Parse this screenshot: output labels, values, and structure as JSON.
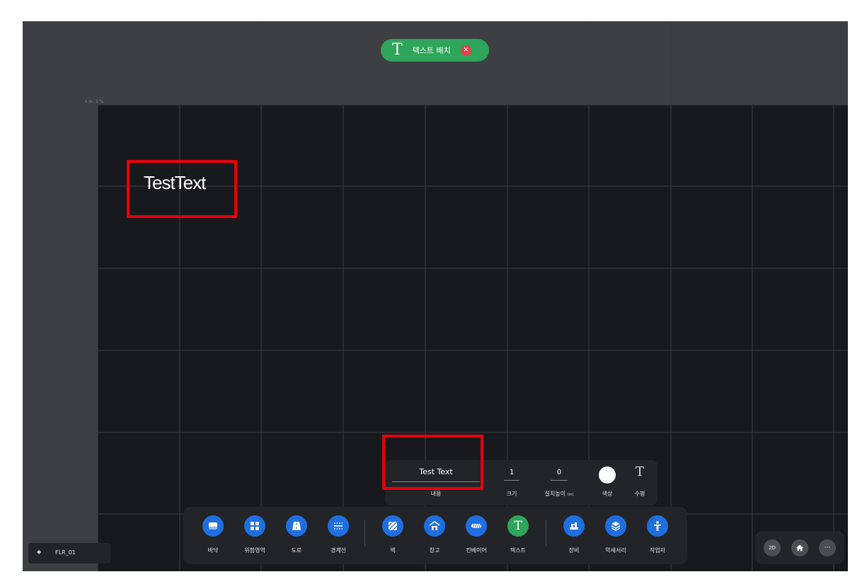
{
  "header": {
    "mode_label": "텍스트 배치",
    "close_symbol": "✕",
    "mode_icon": "text-icon"
  },
  "canvas": {
    "ruler_label": "1 m, 1 %",
    "placed_text": "TestText"
  },
  "text_properties": {
    "content": {
      "value": "Test Text",
      "label": "내용"
    },
    "size": {
      "value": "1",
      "label": "크기"
    },
    "height": {
      "value": "0",
      "label": "설치높이",
      "unit": "(m)"
    },
    "color": {
      "label": "색상",
      "value": "#ffffff"
    },
    "alignment": {
      "label": "수평",
      "icon": "text-align-icon"
    }
  },
  "toolbar": {
    "items": [
      {
        "label": "바닥",
        "icon": "floor-icon"
      },
      {
        "label": "위험영역",
        "icon": "danger-zone-icon"
      },
      {
        "label": "도로",
        "icon": "road-icon"
      },
      {
        "label": "경계선",
        "icon": "boundary-icon"
      },
      {
        "label": "벽",
        "icon": "wall-icon"
      },
      {
        "label": "창고",
        "icon": "warehouse-icon"
      },
      {
        "label": "컨베이어",
        "icon": "conveyor-icon"
      },
      {
        "label": "텍스트",
        "icon": "text-icon",
        "active": true
      },
      {
        "label": "장비",
        "icon": "equipment-icon"
      },
      {
        "label": "악세서리",
        "icon": "accessory-icon"
      },
      {
        "label": "작업자",
        "icon": "worker-icon"
      }
    ]
  },
  "floor": {
    "label": "FLR_01",
    "icon": "layers-icon"
  },
  "view_controls": {
    "mode_2d": "2D",
    "home_icon": "home-icon",
    "more_symbol": "···"
  },
  "colors": {
    "accent_blue": "#1f6fe0",
    "accent_green": "#2ea55a",
    "close_red": "#e2424d",
    "highlight_red": "#e5000d",
    "canvas_bg": "#18191c",
    "panel_bg": "#232428"
  }
}
